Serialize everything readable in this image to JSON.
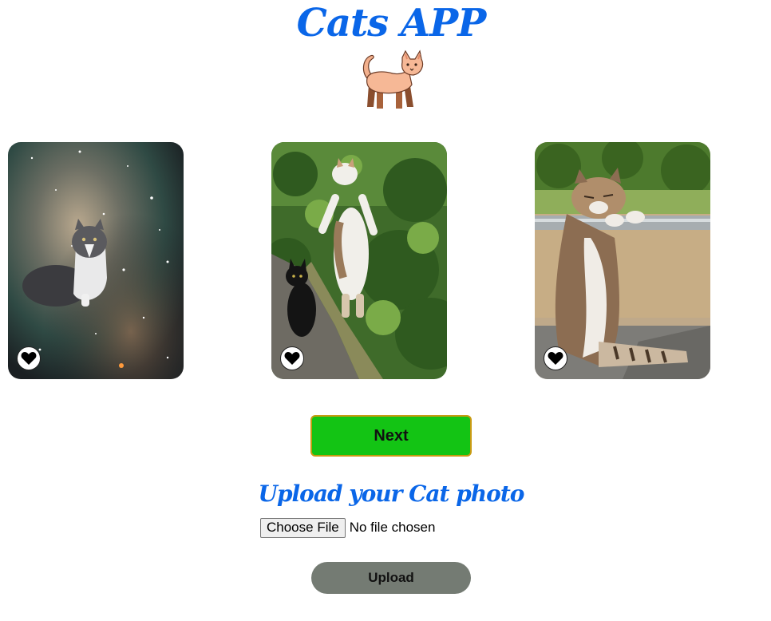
{
  "header": {
    "title": "Cats APP",
    "logo_icon": "cat-emoji-icon"
  },
  "gallery": {
    "cards": [
      {
        "photo": "cat-in-space-photo",
        "favorite_icon": "heart-icon"
      },
      {
        "photo": "cat-standing-in-bushes-photo",
        "favorite_icon": "heart-icon"
      },
      {
        "photo": "cat-leaning-on-rail-photo",
        "favorite_icon": "heart-icon"
      }
    ]
  },
  "actions": {
    "next_label": "Next"
  },
  "upload": {
    "heading": "Upload your Cat photo",
    "choose_label": "Choose File",
    "file_status": "No file chosen",
    "upload_label": "Upload"
  },
  "colors": {
    "title": "#0a66e8",
    "next_bg": "#13c414",
    "next_border": "#c79b12",
    "upload_bg": "#747b73"
  }
}
